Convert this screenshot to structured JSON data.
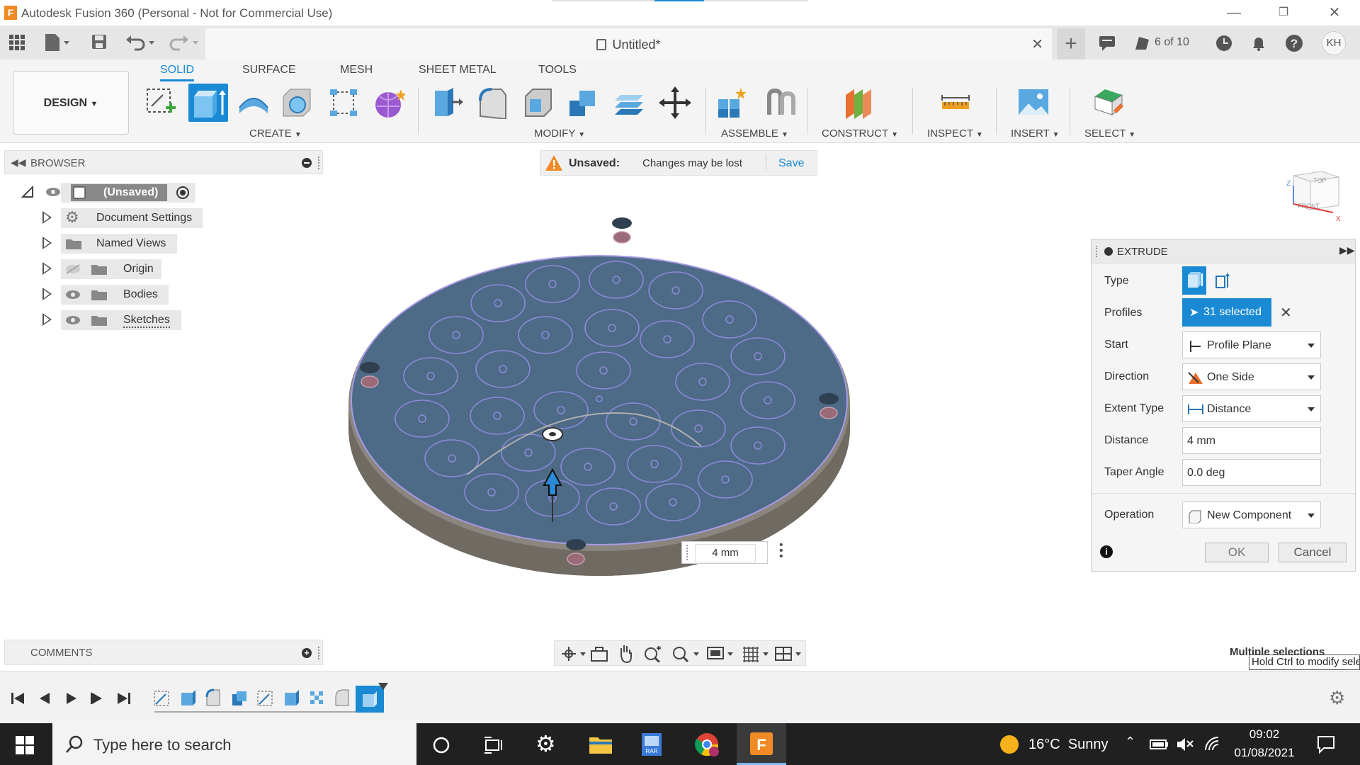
{
  "app": {
    "title": "Autodesk Fusion 360 (Personal - Not for Commercial Use)",
    "logo_letter": "F",
    "document_title": "Untitled*",
    "job_status": "6 of 10",
    "user_initials": "KH",
    "accent_color": "#1a8ad4"
  },
  "ribbon": {
    "workspace_button": "DESIGN",
    "tabs": [
      {
        "label": "SOLID",
        "active": true
      },
      {
        "label": "SURFACE",
        "active": false
      },
      {
        "label": "MESH",
        "active": false
      },
      {
        "label": "SHEET METAL",
        "active": false
      },
      {
        "label": "TOOLS",
        "active": false
      }
    ],
    "groups": {
      "create": "CREATE",
      "modify": "MODIFY",
      "assemble": "ASSEMBLE",
      "construct": "CONSTRUCT",
      "inspect": "INSPECT",
      "insert": "INSERT",
      "select": "SELECT"
    }
  },
  "browser": {
    "header": "BROWSER",
    "root": "(Unsaved)",
    "items": [
      {
        "label": "Document Settings",
        "icon": "gear-icon"
      },
      {
        "label": "Named Views",
        "icon": "folder-icon"
      },
      {
        "label": "Origin",
        "icon": "folder-icon"
      },
      {
        "label": "Bodies",
        "icon": "folder-icon"
      },
      {
        "label": "Sketches",
        "icon": "folder-icon"
      }
    ]
  },
  "banner": {
    "status": "Unsaved:",
    "message": "Changes may be lost",
    "save": "Save"
  },
  "viewcube": {
    "top": "TOP",
    "front": "FRONT"
  },
  "viewport": {
    "distance_input": "4 mm",
    "multi_selection_label": "Multiple selections",
    "tooltip": "Hold Ctrl to modify selection"
  },
  "extrude": {
    "title": "EXTRUDE",
    "type_label": "Type",
    "profiles_label": "Profiles",
    "profiles_value": "31 selected",
    "start_label": "Start",
    "start_value": "Profile Plane",
    "direction_label": "Direction",
    "direction_value": "One Side",
    "extent_label": "Extent Type",
    "extent_value": "Distance",
    "distance_label": "Distance",
    "distance_value": "4 mm",
    "taper_label": "Taper Angle",
    "taper_value": "0.0 deg",
    "operation_label": "Operation",
    "operation_value": "New Component",
    "ok": "OK",
    "cancel": "Cancel"
  },
  "comments": {
    "header": "COMMENTS"
  },
  "taskbar": {
    "search_placeholder": "Type here to search",
    "weather": "16°C  Sunny",
    "time": "09:02",
    "date": "01/08/2021"
  }
}
